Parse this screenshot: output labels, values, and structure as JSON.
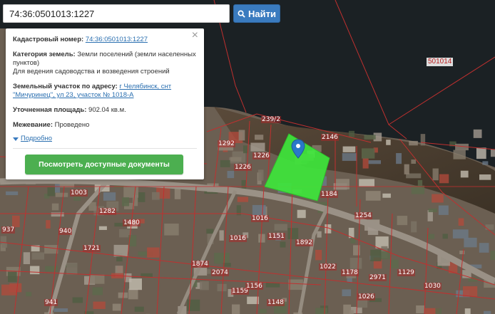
{
  "search": {
    "value": "74:36:0501013:1227",
    "button_label": "Найти"
  },
  "panel": {
    "cadastral_label": "Кадастровый номер:",
    "cadastral_value": "74:36:0501013:1227",
    "category_label": "Категория земель:",
    "category_value": "Земли поселений (земли населенных пунктов)",
    "usage_value": "Для ведения садоводства и возведения строений",
    "address_label": "Земельный участок по адресу:",
    "address_value": "г Челябинск, снт \"Мичуринец\", ул 23, участок № 1018-А",
    "area_label": "Уточненная площадь:",
    "area_value": "902.04 кв.м.",
    "survey_label": "Межевание:",
    "survey_value": "Проведено",
    "more_link": "Подробно",
    "docs_button": "Посмотреть доступные документы"
  },
  "map": {
    "block_label": "501014",
    "parcel_labels": [
      "239/2",
      "2146",
      "1292",
      "1226",
      "1226",
      "1184",
      "1003",
      "1282",
      "1480",
      "940",
      "1254",
      "1016",
      "1151",
      "1892",
      "937",
      "1721",
      "1016",
      "1874",
      "1022",
      "1178",
      "2971",
      "1129",
      "1030",
      "941",
      "2074",
      "1159",
      "1156",
      "1026",
      "1148"
    ],
    "colors": {
      "water": "#1b2124",
      "highlight": "#3ee63b",
      "boundary": "#c0302f",
      "accent": "#3a7bbf"
    }
  }
}
